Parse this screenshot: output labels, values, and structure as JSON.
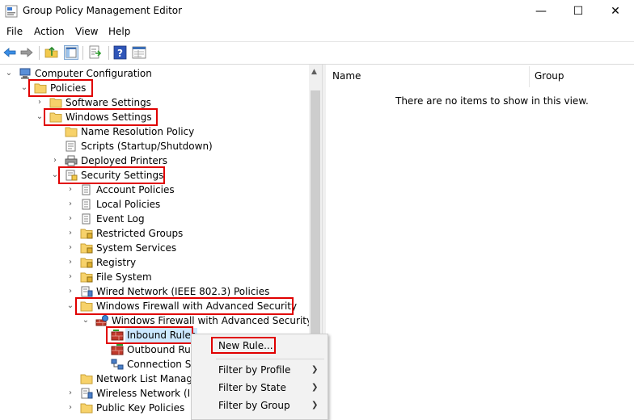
{
  "window": {
    "title": "Group Policy Management Editor",
    "minimize": "—",
    "maximize": "☐",
    "close": "✕"
  },
  "menu": [
    "File",
    "Action",
    "View",
    "Help"
  ],
  "toolbar": [
    "back-icon",
    "forward-icon",
    "up-folder-icon",
    "show-hide-tree-icon",
    "export-list-icon",
    "help-icon",
    "properties-icon"
  ],
  "tree": [
    {
      "label": "Computer Configuration",
      "icon": "computer-icon",
      "chevron": "down"
    },
    {
      "label": "Policies",
      "icon": "folder-icon",
      "chevron": "down",
      "highlighted": true
    },
    {
      "label": "Software Settings",
      "icon": "folder-icon",
      "chevron": "right"
    },
    {
      "label": "Windows Settings",
      "icon": "folder-icon",
      "chevron": "down",
      "highlighted": true
    },
    {
      "label": "Name Resolution Policy",
      "icon": "folder-icon",
      "chevron": "none"
    },
    {
      "label": "Scripts (Startup/Shutdown)",
      "icon": "script-icon",
      "chevron": "none"
    },
    {
      "label": "Deployed Printers",
      "icon": "printer-icon",
      "chevron": "right"
    },
    {
      "label": "Security Settings",
      "icon": "security-icon",
      "chevron": "down",
      "highlighted": true
    },
    {
      "label": "Account Policies",
      "icon": "policy-icon",
      "chevron": "right"
    },
    {
      "label": "Local Policies",
      "icon": "policy-icon",
      "chevron": "right"
    },
    {
      "label": "Event Log",
      "icon": "policy-icon",
      "chevron": "right"
    },
    {
      "label": "Restricted Groups",
      "icon": "locked-folder-icon",
      "chevron": "right"
    },
    {
      "label": "System Services",
      "icon": "locked-folder-icon",
      "chevron": "right"
    },
    {
      "label": "Registry",
      "icon": "locked-folder-icon",
      "chevron": "right"
    },
    {
      "label": "File System",
      "icon": "locked-folder-icon",
      "chevron": "right"
    },
    {
      "label": "Wired Network (IEEE 802.3) Policies",
      "icon": "network-icon",
      "chevron": "right"
    },
    {
      "label": "Windows Firewall with Advanced Security",
      "icon": "folder-icon",
      "chevron": "down",
      "highlighted": true
    },
    {
      "label": "Windows Firewall with Advanced Security - LD",
      "icon": "firewall-icon",
      "chevron": "down"
    },
    {
      "label": "Inbound Rules",
      "icon": "rules-icon",
      "chevron": "none",
      "highlighted": true,
      "selected": true
    },
    {
      "label": "Outbound Rule",
      "icon": "rules-icon",
      "chevron": "none"
    },
    {
      "label": "Connection Se",
      "icon": "connection-icon",
      "chevron": "none"
    },
    {
      "label": "Network List Manager",
      "icon": "folder-icon",
      "chevron": "none"
    },
    {
      "label": "Wireless Network (IEEE",
      "icon": "network-icon",
      "chevron": "right"
    },
    {
      "label": "Public Key Policies",
      "icon": "folder-icon",
      "chevron": "right"
    }
  ],
  "right": {
    "columns": [
      "Name",
      "Group"
    ],
    "empty": "There are no items to show in this view."
  },
  "context_menu": [
    {
      "label": "New Rule...",
      "highlighted": true,
      "submenu": false
    },
    {
      "label": "Filter by Profile",
      "submenu": true
    },
    {
      "label": "Filter by State",
      "submenu": true
    },
    {
      "label": "Filter by Group",
      "submenu": true
    }
  ],
  "glyphs": {
    "chevron_down": "⌄",
    "chevron_right": "›",
    "submenu_arrow": "❯",
    "scroll_up": "▲"
  },
  "colors": {
    "highlight_box": "#e00000",
    "selection": "#cce8ff",
    "folder": "#f7d26a"
  }
}
